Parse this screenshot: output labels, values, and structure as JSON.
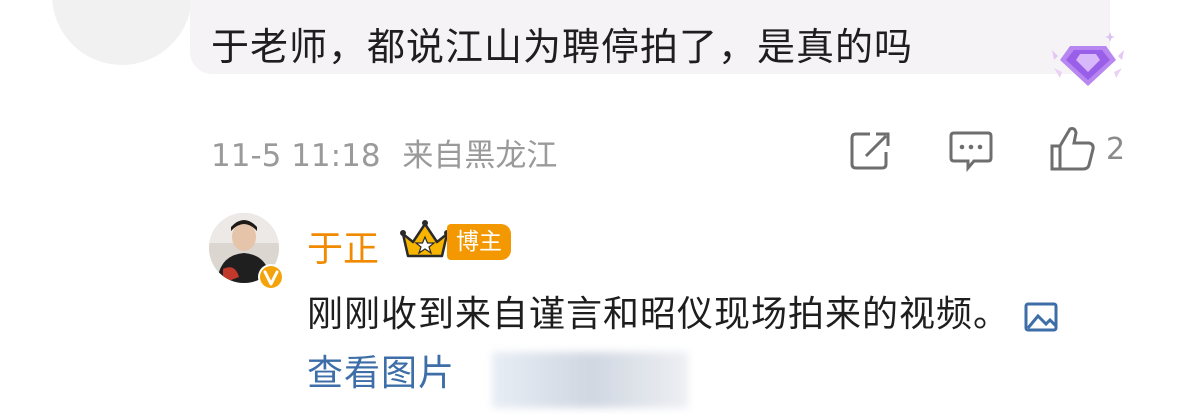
{
  "comment": {
    "text": "于老师，都说江山为聘停拍了，是真的吗",
    "timestamp": "11-5 11:18",
    "location": "来自黑龙江",
    "like_count": "2",
    "badge_icon": "purple-diamond-badge-icon"
  },
  "reply": {
    "author": "于正",
    "tag": "博主",
    "text": "刚刚收到来自谨言和昭仪现场拍来的视频。",
    "link_text": "查看图片"
  },
  "colors": {
    "accent_orange": "#f08a00",
    "tag_orange": "#f39800",
    "link_blue": "#3d6ea7",
    "meta_gray": "#9a9a9a"
  }
}
